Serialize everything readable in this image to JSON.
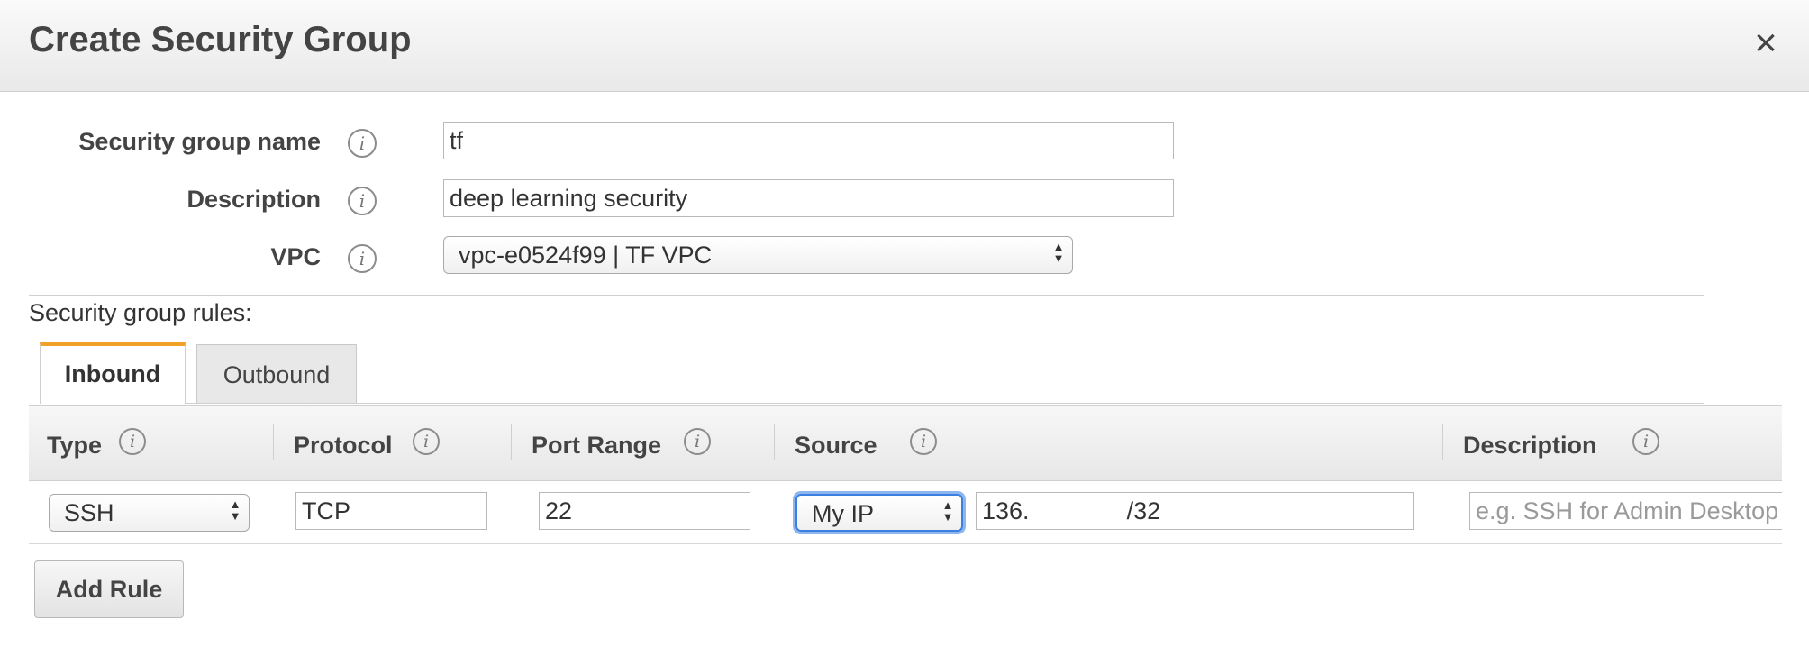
{
  "dialog": {
    "title": "Create Security Group",
    "close_glyph": "×"
  },
  "form": {
    "name_label": "Security group name",
    "name_value": "tf",
    "description_label": "Description",
    "description_value": "deep learning security",
    "vpc_label": "VPC",
    "vpc_value": "vpc-e0524f99 | TF VPC"
  },
  "rules": {
    "caption": "Security group rules:",
    "tabs": [
      {
        "label": "Inbound",
        "active": true
      },
      {
        "label": "Outbound",
        "active": false
      }
    ],
    "columns": [
      "Type",
      "Protocol",
      "Port Range",
      "Source",
      "Description"
    ],
    "row": {
      "type": "SSH",
      "protocol": "TCP",
      "port_range": "22",
      "source_select": "My IP",
      "source_cidr_prefix": "136.",
      "source_cidr_suffix": "/32",
      "description_placeholder": "e.g. SSH for Admin Desktop"
    },
    "add_rule_label": "Add Rule"
  },
  "icons": {
    "info": "info-icon",
    "close": "close-icon",
    "select_arrows": "up-down-arrows-icon"
  },
  "colors": {
    "active_tab_accent": "#f0a228",
    "focus_ring": "#3b7fe0"
  }
}
